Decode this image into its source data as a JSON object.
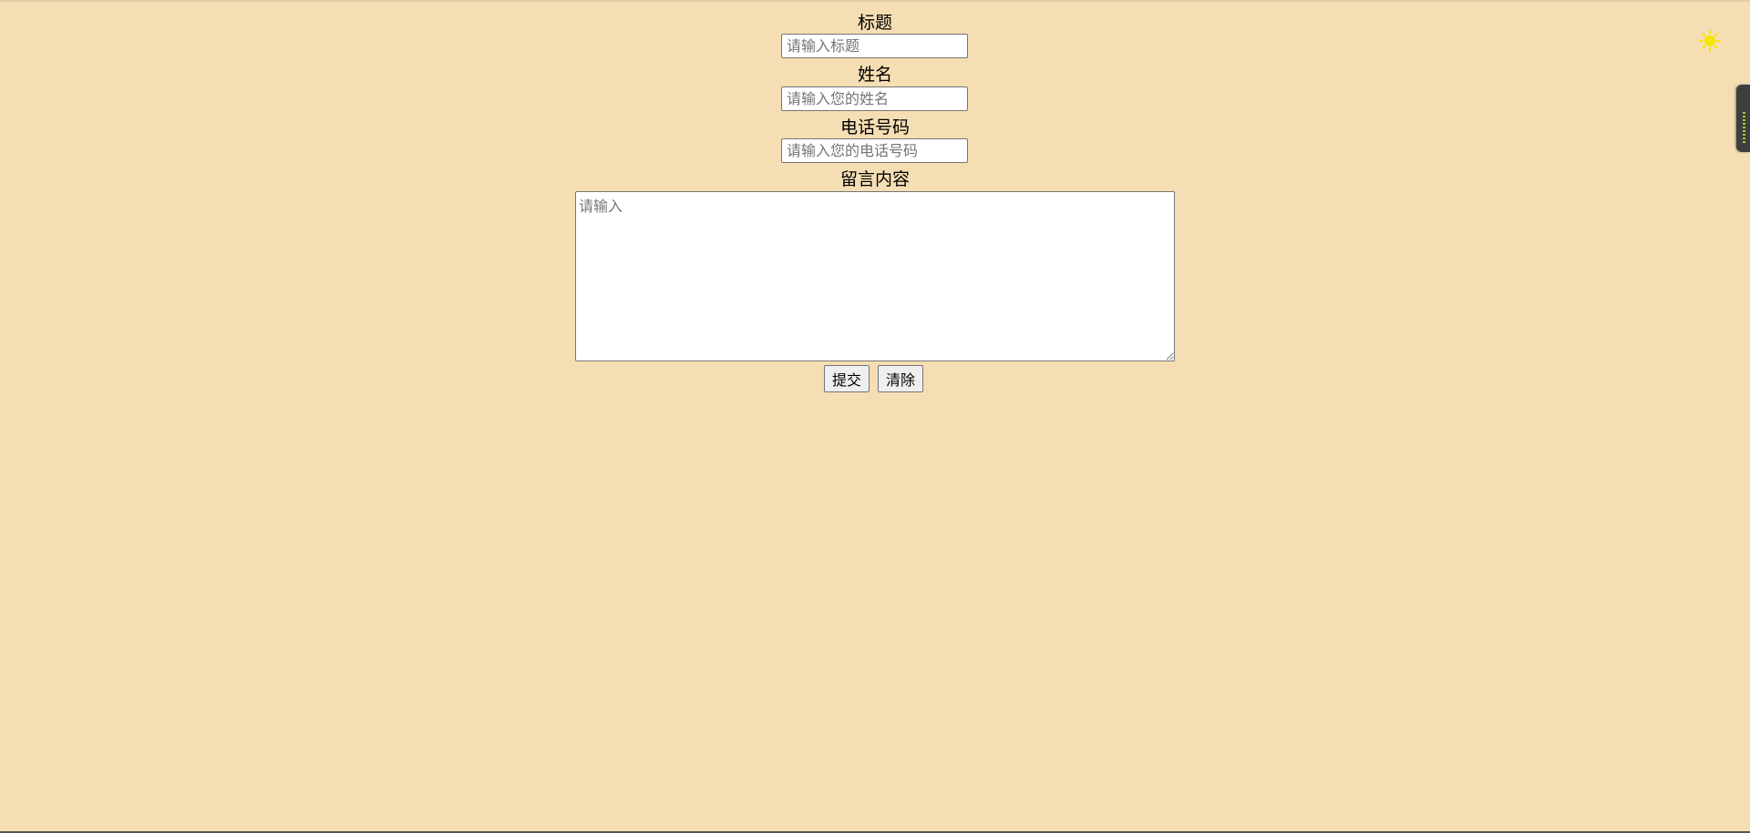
{
  "form": {
    "title_label": "标题",
    "title_placeholder": "请输入标题",
    "name_label": "姓名",
    "name_placeholder": "请输入您的姓名",
    "phone_label": "电话号码",
    "phone_placeholder": "请输入您的电话号码",
    "message_label": "留言内容",
    "message_placeholder": "请输入",
    "submit_label": "提交",
    "clear_label": "清除"
  },
  "theme": {
    "background": "#f5deb3",
    "toggle_icon": "sun-icon",
    "toggle_color": "#f5e500"
  }
}
